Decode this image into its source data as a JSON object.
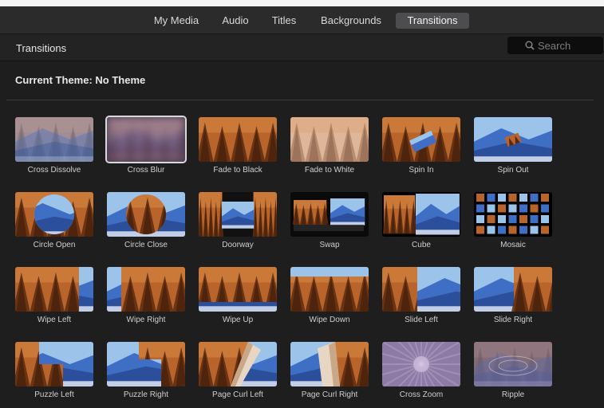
{
  "tabs": [
    {
      "label": "My Media",
      "active": false
    },
    {
      "label": "Audio",
      "active": false
    },
    {
      "label": "Titles",
      "active": false
    },
    {
      "label": "Backgrounds",
      "active": false
    },
    {
      "label": "Transitions",
      "active": true
    }
  ],
  "header": {
    "title": "Transitions",
    "search_placeholder": "Search"
  },
  "theme_label": "Current Theme: No Theme",
  "colors": {
    "forest": "#b8642a",
    "mountain": "#3f6fc4",
    "sky": "#9cc3ea",
    "selection": "#d9d9d9"
  },
  "transitions": [
    {
      "label": "Cross Dissolve",
      "style": "dissolve"
    },
    {
      "label": "Cross Blur",
      "style": "blur",
      "selected": true
    },
    {
      "label": "Fade to Black",
      "style": "forest"
    },
    {
      "label": "Fade to White",
      "style": "white"
    },
    {
      "label": "Spin In",
      "style": "spin-in"
    },
    {
      "label": "Spin Out",
      "style": "spin-out"
    },
    {
      "label": "Circle Open",
      "style": "circle-open"
    },
    {
      "label": "Circle Close",
      "style": "circle-close"
    },
    {
      "label": "Doorway",
      "style": "doorway"
    },
    {
      "label": "Swap",
      "style": "swap"
    },
    {
      "label": "Cube",
      "style": "cube"
    },
    {
      "label": "Mosaic",
      "style": "mosaic"
    },
    {
      "label": "Wipe Left",
      "style": "wipe-left"
    },
    {
      "label": "Wipe Right",
      "style": "wipe-right"
    },
    {
      "label": "Wipe Up",
      "style": "wipe-up"
    },
    {
      "label": "Wipe Down",
      "style": "wipe-down"
    },
    {
      "label": "Slide Left",
      "style": "slide-left"
    },
    {
      "label": "Slide Right",
      "style": "slide-right"
    },
    {
      "label": "Puzzle Left",
      "style": "puzzle-left"
    },
    {
      "label": "Puzzle Right",
      "style": "puzzle-right"
    },
    {
      "label": "Page Curl Left",
      "style": "curl-left"
    },
    {
      "label": "Page Curl Right",
      "style": "curl-right"
    },
    {
      "label": "Cross Zoom",
      "style": "zoom"
    },
    {
      "label": "Ripple",
      "style": "ripple"
    }
  ]
}
